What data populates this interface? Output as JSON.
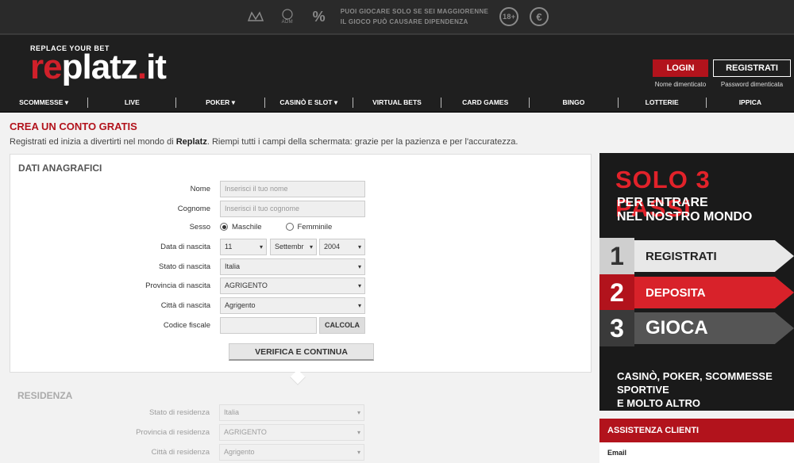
{
  "topbar": {
    "adm_label": "ADM",
    "percent_symbol": "%",
    "message_line1": "PUOI GIOCARE SOLO SE SEI MAGGIORENNE",
    "message_line2": "IL GIOCO PUÒ CAUSARE DIPENDENZA",
    "age_badge": "18+",
    "euro_symbol": "€"
  },
  "header": {
    "logo_tagline": "REPLACE YOUR BET",
    "logo_re": "re",
    "logo_platz": "platz",
    "logo_dot": ".",
    "logo_it": "it",
    "login_label": "LOGIN",
    "register_label": "REGISTRATI",
    "forgot_name": "Nome dimenticato",
    "forgot_password": "Password dimenticata"
  },
  "nav": {
    "items": [
      {
        "label": "SCOMMESSE",
        "dropdown": true
      },
      {
        "label": "LIVE",
        "dropdown": false
      },
      {
        "label": "POKER",
        "dropdown": true
      },
      {
        "label": "CASINÒ E SLOT",
        "dropdown": true
      },
      {
        "label": "VIRTUAL BETS",
        "dropdown": false
      },
      {
        "label": "CARD GAMES",
        "dropdown": false
      },
      {
        "label": "BINGO",
        "dropdown": false
      },
      {
        "label": "LOTTERIE",
        "dropdown": false
      },
      {
        "label": "IPPICA",
        "dropdown": false
      }
    ]
  },
  "page": {
    "title": "CREA UN CONTO GRATIS",
    "intro_before": "Registrati ed inizia a divertirti nel mondo di ",
    "intro_brand": "Replatz",
    "intro_after": ". Riempi tutti i campi della schermata: grazie per la pazienza e per l'accuratezza."
  },
  "form": {
    "section_title": "DATI ANAGRAFICI",
    "nome_label": "Nome",
    "nome_placeholder": "Inserisci il tuo nome",
    "cognome_label": "Cognome",
    "cognome_placeholder": "Inserisci il tuo cognome",
    "sesso_label": "Sesso",
    "sesso_m": "Maschile",
    "sesso_f": "Femminile",
    "nascita_label": "Data di nascita",
    "day_value": "11",
    "month_value": "Settembr",
    "year_value": "2004",
    "stato_label": "Stato di nascita",
    "stato_value": "Italia",
    "provincia_label": "Provincia di nascita",
    "provincia_value": "AGRIGENTO",
    "citta_label": "Città di nascita",
    "citta_value": "Agrigento",
    "cf_label": "Codice fiscale",
    "calcola_label": "CALCOLA",
    "verifica_label": "VERIFICA E CONTINUA"
  },
  "residenza": {
    "section_title": "RESIDENZA",
    "stato_label": "Stato di residenza",
    "stato_value": "Italia",
    "provincia_label": "Provincia di residenza",
    "provincia_value": "AGRIGENTO",
    "citta_label": "Città di residenza",
    "citta_value": "Agrigento"
  },
  "banner": {
    "headline": "SOLO 3 PASSI",
    "sub1": "PER ENTRARE",
    "sub2": "NEL NOSTRO MONDO",
    "steps": [
      {
        "num": "1",
        "label": "REGISTRATI"
      },
      {
        "num": "2",
        "label": "DEPOSITA"
      },
      {
        "num": "3",
        "label": "GIOCA"
      }
    ],
    "foot1": "CASINÒ, POKER, SCOMMESSE SPORTIVE",
    "foot2": "E MOLTO ALTRO"
  },
  "assistenza": {
    "title": "ASSISTENZA CLIENTI",
    "email_label": "Email"
  },
  "colors": {
    "brand_red": "#b2131c",
    "dark_bg": "#1f1f1f"
  }
}
